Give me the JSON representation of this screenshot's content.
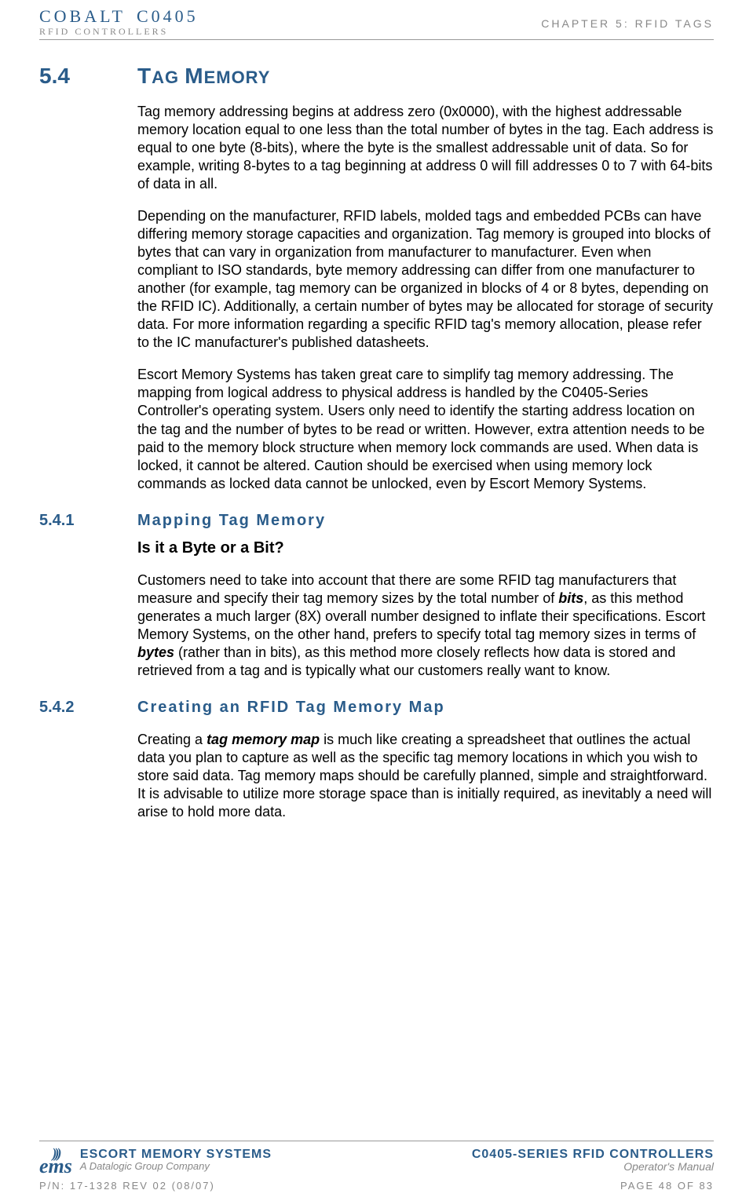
{
  "header": {
    "brand_name": "COBALT",
    "brand_model": "C0405",
    "brand_sub": "RFID CONTROLLERS",
    "chapter": "CHAPTER 5: RFID TAGS"
  },
  "section": {
    "num": "5.4",
    "title_pre": "T",
    "title_small": "AG ",
    "title_pre2": "M",
    "title_small2": "EMORY"
  },
  "p1": "Tag memory addressing begins at address zero (0x0000), with the highest addressable memory location equal to one less than the total number of bytes in the tag. Each address is equal to one byte (8-bits), where the byte is the smallest addressable unit of data. So for example, writing 8-bytes to a tag beginning at address 0 will fill addresses 0 to 7 with 64-bits of data in all.",
  "p2": "Depending on the manufacturer, RFID labels, molded tags and embedded PCBs can have differing memory storage capacities and organization. Tag memory is grouped into blocks of bytes that can vary in organization from manufacturer to manufacturer. Even when compliant to ISO standards, byte memory addressing can differ from one manufacturer to another (for example, tag memory can be organized in blocks of 4 or 8 bytes, depending on the RFID IC). Additionally, a certain number of bytes may be allocated for storage of security data. For more information regarding a specific RFID tag's memory allocation, please refer to the IC manufacturer's published datasheets.",
  "p3": "Escort Memory Systems has taken great care to simplify tag memory addressing. The mapping from logical address to physical address is handled by the C0405-Series Controller's operating system. Users only need to identify the starting address location on the tag and the number of bytes to be read or written. However, extra attention needs to be paid to the memory block structure when memory lock commands are used. When data is locked, it cannot be altered. Caution should be exercised when using memory lock commands as locked data cannot be unlocked, even by Escort Memory Systems.",
  "sub1": {
    "num": "5.4.1",
    "title": "Mapping Tag Memory",
    "h3": "Is it a Byte or a Bit?",
    "para_a": "Customers need to take into account that there are some RFID tag manufacturers that measure and specify their tag memory sizes by the total number of ",
    "para_b": "bits",
    "para_c": ", as this method generates a much larger (8X) overall number designed to inflate their specifications. Escort Memory Systems, on the other hand, prefers to specify total tag memory sizes in terms of ",
    "para_d": "bytes",
    "para_e": " (rather than in bits), as this method more closely reflects how data is stored and retrieved from a tag and is typically what our customers really want to know."
  },
  "sub2": {
    "num": "5.4.2",
    "title": "Creating an RFID Tag Memory Map",
    "para_a": "Creating a ",
    "para_b": "tag memory map",
    "para_c": " is much like creating a spreadsheet that outlines the actual data you plan to capture as well as the specific tag memory locations in which you wish to store said data. Tag memory maps should be carefully planned, simple and straightforward. It is advisable to utilize more storage space than is initially required, as inevitably a need will arise to hold more data."
  },
  "footer": {
    "ems_name": "ESCORT MEMORY SYSTEMS",
    "ems_sub": "A Datalogic Group Company",
    "ems_logo": "ems",
    "ctrl_name": "C0405-SERIES RFID CONTROLLERS",
    "ctrl_sub": "Operator's Manual",
    "pn": "P/N: 17-1328 REV 02 (08/07)",
    "page": "PAGE 48 OF 83"
  }
}
